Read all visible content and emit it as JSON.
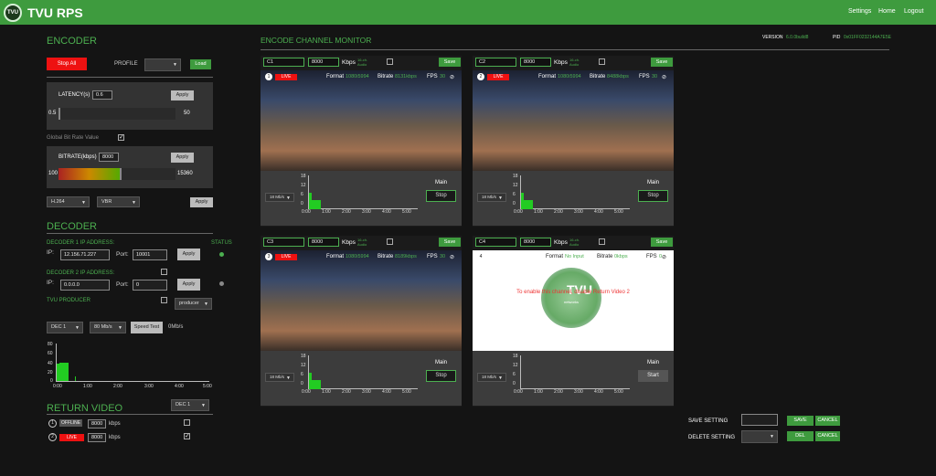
{
  "app": {
    "logo": "TVU",
    "title": "TVU RPS"
  },
  "nav": {
    "settings": "Settings",
    "home": "Home",
    "logout": "Logout"
  },
  "encoder": {
    "title": "ENCODER",
    "stop_all": "Stop All",
    "profile_label": "PROFILE",
    "profile_value": "",
    "load": "Load",
    "latency_label": "LATENCY(s)",
    "latency_value": "0.6",
    "apply": "Apply",
    "latency_min": "0.5",
    "latency_max": "50",
    "latency_level": 0.0,
    "global_bitrate_label": "Global Bit Rate Value",
    "global_bitrate_checked": true,
    "bitrate_label": "BITRATE(kbps)",
    "bitrate_value": "8000",
    "bitrate_min": "100",
    "bitrate_max": "15360",
    "bitrate_level": 0.52,
    "codec": "H.264",
    "rate_mode": "VBR"
  },
  "decoder": {
    "title": "DECODER",
    "d1_label": "DECODER 1 IP ADDRESS:",
    "status_label": "STATUS",
    "ip_label": "IP:",
    "port_label": "Port:",
    "d1_ip": "12.156.71.227",
    "d1_port": "10001",
    "d2_label": "DECODER 2 IP ADDRESS:",
    "d2_ip": "0.0.0.0",
    "d2_port": "0",
    "tvu_producer": "TVU PRODUCER",
    "producer_select": "producer",
    "dec_select": "DEC 1",
    "speed_select": "80 Mb/s",
    "speed_test": "Speed Test",
    "speed_result": "0Mb/s",
    "chart": {
      "y_ticks": [
        "80",
        "60",
        "40",
        "20",
        "0"
      ],
      "x_ticks": [
        "0:00",
        "1:00",
        "2:00",
        "3:00",
        "4:00",
        "5:00"
      ]
    },
    "status_colors": [
      "#4caf50",
      "#888"
    ]
  },
  "return_video": {
    "title": "RETURN VIDEO",
    "dec_select": "DEC 1",
    "items": [
      {
        "num": "1",
        "status": "OFFLINE",
        "value": "8000",
        "unit": "kbps",
        "checked": false
      },
      {
        "num": "2",
        "status": "LIVE",
        "value": "8000",
        "unit": "kbps",
        "checked": true
      }
    ]
  },
  "monitor": {
    "title": "ENCODE CHANNEL MONITOR",
    "version_label": "VERSION",
    "version_value": "6.0.0build8",
    "pid_label": "PID",
    "pid_value": "0x01FF0232144A7E5E",
    "common": {
      "format_label": "Format",
      "bitrate_label": "Bitrate",
      "fps_label": "FPS",
      "kbps": "Kbps",
      "save": "Save",
      "main": "Main",
      "live": "LIVE",
      "rate_select": "18 Mb/s",
      "audio": "16-ch. Audio",
      "y_ticks": [
        "18",
        "12",
        "6",
        "0"
      ],
      "x_ticks": [
        "0:00",
        "1:00",
        "2:00",
        "3:00",
        "4:00",
        "5:00"
      ]
    },
    "channels": [
      {
        "name": "C1",
        "bitrate_in": "8000",
        "num": "1",
        "live": true,
        "format": "1080i5994",
        "bitrate": "8131kbps",
        "fps": "30",
        "action": "Stop"
      },
      {
        "name": "C2",
        "bitrate_in": "8000",
        "num": "2",
        "live": true,
        "format": "1080i5994",
        "bitrate": "8488kbps",
        "fps": "30",
        "action": "Stop"
      },
      {
        "name": "C3",
        "bitrate_in": "8000",
        "num": "3",
        "live": true,
        "format": "1080i5994",
        "bitrate": "8189kbps",
        "fps": "30",
        "action": "Stop"
      },
      {
        "name": "C4",
        "bitrate_in": "8000",
        "num": "4",
        "live": false,
        "format": "No Input",
        "bitrate": "0kbps",
        "fps": "0",
        "action": "Start",
        "message": "To enable this channel, disable Return Video 2",
        "brand": "TVU",
        "brand_sub": "networks"
      }
    ]
  },
  "settings": {
    "save_label": "SAVE SETTING",
    "delete_label": "DELETE SETTING",
    "save": "SAVE",
    "cancel": "CANCEL",
    "del": "DEL",
    "cancel2": "CANCEL"
  }
}
